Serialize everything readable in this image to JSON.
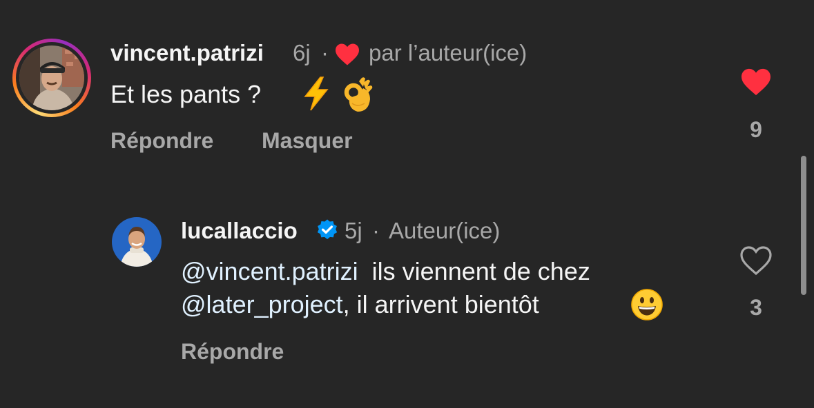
{
  "comments": [
    {
      "username": "vincent.patrizi",
      "age": "6j",
      "separator": "·",
      "author_like_label": "par l’auteur(ice)",
      "text": "Et les pants ?",
      "emojis": [
        "lightning-emoji",
        "ok-hand-emoji"
      ],
      "actions": {
        "reply": "Répondre",
        "hide": "Masquer"
      },
      "like_count": "9",
      "liked": true
    },
    {
      "username": "lucallaccio",
      "verified": true,
      "age": "5j",
      "separator": "·",
      "author_label": "Auteur(ice)",
      "mention_1": "@vincent.patrizi",
      "text_1": "ils viennent de chez",
      "mention_2": "@later_project",
      "text_2": ", il arrivent bientôt",
      "emojis": [
        "smiley-emoji"
      ],
      "actions": {
        "reply": "Répondre"
      },
      "like_count": "3",
      "liked": false
    }
  ],
  "colors": {
    "background": "#262626",
    "primary_text": "#f5f5f5",
    "secondary_text": "#a8a8a8",
    "mention": "#e0f1ff",
    "like_red": "#ff3040",
    "verified_blue": "#0095f6"
  }
}
